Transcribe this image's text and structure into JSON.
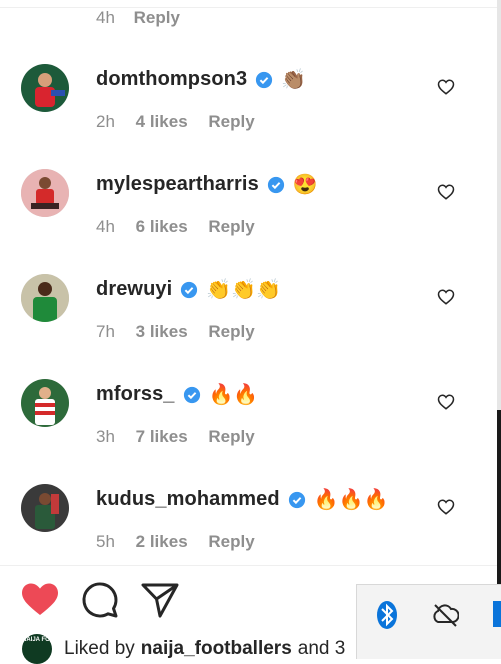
{
  "top_comment": {
    "time": "4h",
    "reply": "Reply"
  },
  "comments": [
    {
      "username": "domthompson3",
      "emoji": "👏🏽",
      "time": "2h",
      "likes": "4 likes",
      "reply": "Reply"
    },
    {
      "username": "mylespeartharris",
      "emoji": "😍",
      "time": "4h",
      "likes": "6 likes",
      "reply": "Reply"
    },
    {
      "username": "drewuyi",
      "emoji": "👏👏👏",
      "time": "7h",
      "likes": "3 likes",
      "reply": "Reply"
    },
    {
      "username": "mforss_",
      "emoji": "🔥🔥",
      "time": "3h",
      "likes": "7 likes",
      "reply": "Reply"
    },
    {
      "username": "kudus_mohammed",
      "emoji": "🔥🔥🔥",
      "time": "5h",
      "likes": "2 likes",
      "reply": "Reply"
    }
  ],
  "liked_by": {
    "prefix": "Liked by",
    "user": "naija_footballers",
    "suffix": "and 3"
  },
  "liked_avatar_text": "NAIJA FOOT",
  "icons": {
    "like": "heart-filled-icon",
    "comment": "comment-bubble-icon",
    "share": "paper-plane-icon",
    "comment_like": "heart-outline-icon",
    "verified": "verified-badge-icon",
    "tray_bluetooth": "bluetooth-icon",
    "tray_cloud": "cloud-offline-icon"
  },
  "colors": {
    "like_red": "#ed4956",
    "verified_blue": "#3897f0",
    "meta_gray": "#8e8e8e"
  }
}
